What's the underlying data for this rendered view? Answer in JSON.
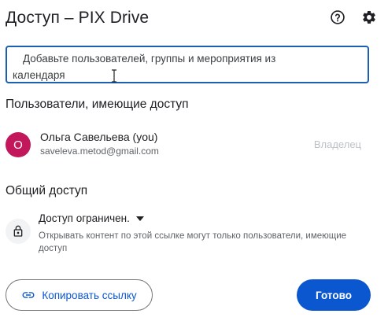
{
  "header": {
    "title": "Доступ – PIX Drive",
    "help_icon": "help-circle-icon",
    "settings_icon": "gear-icon"
  },
  "add_people": {
    "placeholder_line1": "Добавьте пользователей, группы и мероприятия из",
    "placeholder_line2": "календаря"
  },
  "people_with_access": {
    "title": "Пользователи, имеющие доступ",
    "users": [
      {
        "avatar_letter": "О",
        "name": "Ольга Савельева (you)",
        "email": "saveleva.metod@gmail.com",
        "role": "Владелец",
        "avatar_color": "#c2185b"
      }
    ]
  },
  "general_access": {
    "title": "Общий доступ",
    "icon": "lock-icon",
    "selected_option": "Доступ ограничен.",
    "description": "Открывать контент по этой ссылке могут только пользователи, имеющие доступ"
  },
  "footer": {
    "copy_link_label": "Копировать ссылку",
    "copy_link_icon": "link-icon",
    "done_label": "Готово"
  },
  "colors": {
    "accent": "#0b57d0",
    "input_border": "#1a5fb4"
  }
}
